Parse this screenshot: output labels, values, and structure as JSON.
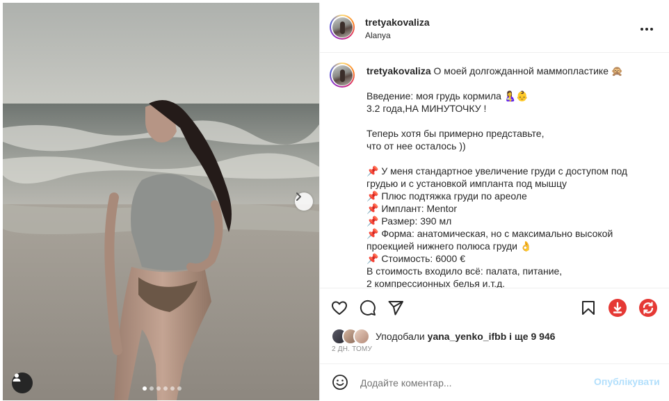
{
  "post": {
    "username": "tretyakovaliza",
    "location": "Alanya",
    "more_icon": "more-horizontal-icon",
    "carousel": {
      "slides": 6,
      "active_index": 0
    }
  },
  "caption": {
    "username": "tretyakovaliza",
    "title": "О моей долгожданной маммопластике 🙊",
    "lines": [
      "",
      "Введение: моя грудь кормила 🤱👶",
      "3.2 года,НА МИНУТОЧКУ !",
      "",
      "Теперь хотя бы примерно представьте,",
      "что от нее осталось ))",
      "",
      "📌 У меня стандартное увеличение груди с доступом под",
      "грудью и с установкой импланта под мышцу",
      "📌 Плюс подтяжка груди по ареоле",
      "📌 Имплант: Mentor",
      "📌 Размер: 390 мл",
      "📌 Форма: анатомическая, но с максимально высокой",
      "проекцией нижнего полюса груди 👌",
      "📌 Стоимость: 6000 €",
      "В стоимость входило всё: палата, питание,",
      "2 компрессионных белья и.т.д."
    ]
  },
  "actions": {
    "like_icon": "heart-icon",
    "comment_icon": "comment-icon",
    "share_icon": "share-icon",
    "save_icon": "bookmark-icon",
    "download_icon": "download-icon",
    "repost_icon": "repost-icon",
    "download_color": "#e53935",
    "repost_color": "#e53935"
  },
  "likes": {
    "prefix": "Уподобали",
    "user": "yana_yenko_ifbb",
    "middle": "і ще",
    "count": "9 946"
  },
  "time": "2 ДН. ТОМУ",
  "comment": {
    "placeholder": "Додайте коментар...",
    "publish_label": "Опублікувати",
    "publish_color": "#b2dffc"
  }
}
